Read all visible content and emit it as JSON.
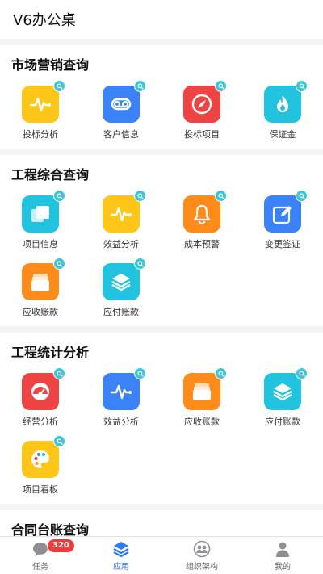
{
  "header": {
    "title": "V6办公桌"
  },
  "sections": [
    {
      "title": "市场营销查询",
      "items": [
        {
          "label": "投标分析",
          "icon": "pulse-icon",
          "color": "#ffc61a"
        },
        {
          "label": "客户信息",
          "icon": "voicemail-icon",
          "color": "#3b82f6"
        },
        {
          "label": "投标项目",
          "icon": "compass-icon",
          "color": "#ef4444"
        },
        {
          "label": "保证金",
          "icon": "flame-icon",
          "color": "#22c3de"
        }
      ]
    },
    {
      "title": "工程综合查询",
      "items": [
        {
          "label": "项目信息",
          "icon": "squares-icon",
          "color": "#22c3de"
        },
        {
          "label": "效益分析",
          "icon": "pulse-icon",
          "color": "#ffc61a"
        },
        {
          "label": "成本预警",
          "icon": "bell-icon",
          "color": "#ff8c1a"
        },
        {
          "label": "变更签证",
          "icon": "edit-icon",
          "color": "#3b82f6"
        },
        {
          "label": "应收账款",
          "icon": "folder-icon",
          "color": "#ff8c1a"
        },
        {
          "label": "应付账款",
          "icon": "layers-icon",
          "color": "#22c3de"
        }
      ]
    },
    {
      "title": "工程统计分析",
      "items": [
        {
          "label": "经营分析",
          "icon": "gauge-icon",
          "color": "#ef4444"
        },
        {
          "label": "效益分析",
          "icon": "pulse-icon",
          "color": "#3b82f6"
        },
        {
          "label": "应收账款",
          "icon": "folder-icon",
          "color": "#ff8c1a"
        },
        {
          "label": "应付账款",
          "icon": "layers-icon",
          "color": "#22c3de"
        },
        {
          "label": "项目看板",
          "icon": "palette-icon",
          "color": "#ffc61a"
        }
      ]
    },
    {
      "title": "合同台账查询",
      "items": [
        {
          "label": "",
          "icon": "app-icon",
          "color": "#ffc61a"
        },
        {
          "label": "",
          "icon": "app-icon",
          "color": "#22c3de"
        }
      ]
    }
  ],
  "tabbar": {
    "tabs": [
      {
        "label": "任务",
        "icon": "chat-icon",
        "badge": "320"
      },
      {
        "label": "应用",
        "icon": "layers-icon",
        "active": true
      },
      {
        "label": "组织架构",
        "icon": "org-icon"
      },
      {
        "label": "我的",
        "icon": "user-icon"
      }
    ]
  }
}
